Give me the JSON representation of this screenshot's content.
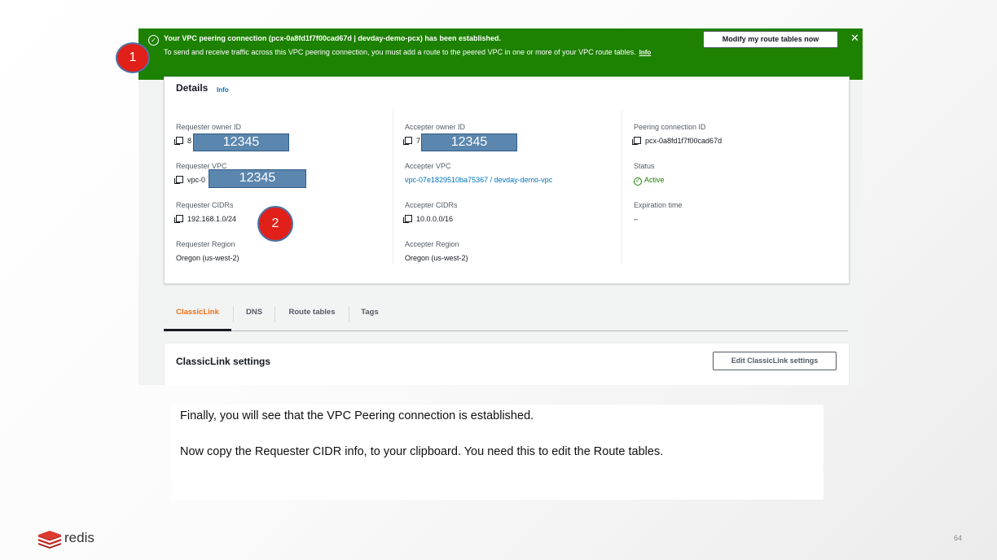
{
  "banner": {
    "title": "Your VPC peering connection (pcx-0a8fd1f7f00cad67d | devday-demo-pcx) has been established.",
    "description": "To send and receive traffic across this VPC peering connection, you must add a route to the peered VPC in one or more of your VPC route tables.",
    "info_link": "Info",
    "action_button": "Modify my route tables now",
    "close_symbol": "✕",
    "success_icon": "check-circle-icon",
    "color": "#1d8102"
  },
  "details": {
    "heading": "Details",
    "info_link": "Info",
    "requester_owner_id": {
      "label": "Requester owner ID",
      "value_prefix": "8",
      "redacted": "12345"
    },
    "requester_vpc": {
      "label": "Requester VPC",
      "value_prefix": "vpc-0",
      "redacted": "12345"
    },
    "requester_cidrs": {
      "label": "Requester CIDRs",
      "value": "192.168.1.0/24"
    },
    "requester_region": {
      "label": "Requester Region",
      "value": "Oregon (us-west-2)"
    },
    "accepter_owner_id": {
      "label": "Accepter owner ID",
      "value_prefix": "7",
      "redacted": "12345"
    },
    "accepter_vpc": {
      "label": "Accepter VPC",
      "value": "vpc-07e1829510ba75367 / devday-demo-vpc"
    },
    "accepter_cidrs": {
      "label": "Accepter CIDRs",
      "value": "10.0.0.0/16"
    },
    "accepter_region": {
      "label": "Accepter Region",
      "value": "Oregon (us-west-2)"
    },
    "peering_connection_id": {
      "label": "Peering connection ID",
      "value": "pcx-0a8fd1f7f00cad67d"
    },
    "status": {
      "label": "Status",
      "value": "Active"
    },
    "expiration_time": {
      "label": "Expiration time",
      "value": "–"
    }
  },
  "tabs": [
    "ClassicLink",
    "DNS",
    "Route tables",
    "Tags"
  ],
  "active_tab": "ClassicLink",
  "classiclink": {
    "title": "ClassicLink settings",
    "edit_button": "Edit ClassicLink settings"
  },
  "markers": [
    "1",
    "2"
  ],
  "caption": {
    "line1": "Finally, you will see that the VPC Peering connection is established.",
    "line2": "Now copy the Requester CIDR info, to your clipboard. You need this to edit the Route tables."
  },
  "footer": {
    "logo_text": "redis",
    "page_number": "64"
  },
  "colors": {
    "success_green": "#1d8102",
    "link_blue": "#0073bb",
    "active_tab_orange": "#ec7211",
    "marker_red": "#e1201a",
    "redaction_blue": "#5b86ad"
  }
}
